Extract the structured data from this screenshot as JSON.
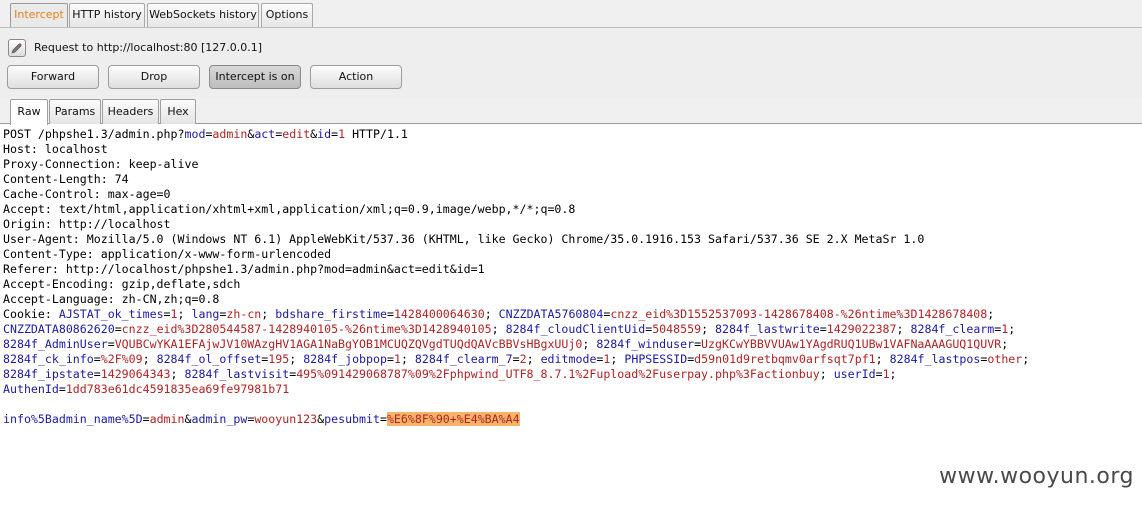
{
  "top_tabs": [
    "Intercept",
    "HTTP history",
    "WebSockets history",
    "Options"
  ],
  "request_label": "Request to http://localhost:80  [127.0.0.1]",
  "buttons": {
    "forward": "Forward",
    "drop": "Drop",
    "intercept": "Intercept is on",
    "action": "Action"
  },
  "sub_tabs": [
    "Raw",
    "Params",
    "Headers",
    "Hex"
  ],
  "request": {
    "request_line": {
      "method_path": "POST /phpshe1.3/admin.php?",
      "params": [
        [
          "mod",
          "admin"
        ],
        [
          "act",
          "edit"
        ],
        [
          "id",
          "1"
        ]
      ],
      "suffix": " HTTP/1.1"
    },
    "headers": [
      "Host: localhost",
      "Proxy-Connection: keep-alive",
      "Content-Length: 74",
      "Cache-Control: max-age=0",
      "Accept: text/html,application/xhtml+xml,application/xml;q=0.9,image/webp,*/*;q=0.8",
      "Origin: http://localhost",
      "User-Agent: Mozilla/5.0 (Windows NT 6.1) AppleWebKit/537.36 (KHTML, like Gecko) Chrome/35.0.1916.153 Safari/537.36 SE 2.X MetaSr 1.0",
      "Content-Type: application/x-www-form-urlencoded",
      "Referer: http://localhost/phpshe1.3/admin.php?mod=admin&act=edit&id=1",
      "Accept-Encoding: gzip,deflate,sdch",
      "Accept-Language: zh-CN,zh;q=0.8"
    ],
    "cookie_label": "Cookie:",
    "cookie_lines": [
      [
        [
          "AJSTAT_ok_times",
          "1"
        ],
        [
          "lang",
          "zh-cn"
        ],
        [
          "bdshare_firstime",
          "1428400064630"
        ],
        [
          "CNZZDATA5760804",
          "cnzz_eid%3D1552537093-1428678408-%26ntime%3D1428678408"
        ]
      ],
      [
        [
          "CNZZDATA80862620",
          "cnzz_eid%3D280544587-1428940105-%26ntime%3D1428940105"
        ],
        [
          "8284f_cloudClientUid",
          "5048559"
        ],
        [
          "8284f_lastwrite",
          "1429022387"
        ],
        [
          "8284f_clearm",
          "1"
        ]
      ],
      [
        [
          "8284f_AdminUser",
          "VQUBCwYKA1EFAjwJV10WAzgHV1AGA1NaBgYOB1MCUQZQVgdTUQdQAVcBBVsHBgxUUj0"
        ],
        [
          "8284f_winduser",
          "UzgKCwYBBVVUAw1YAgdRUQ1UBw1VAFNaAAAGUQ1QUVR"
        ]
      ],
      [
        [
          "8284f_ck_info",
          "%2F%09"
        ],
        [
          "8284f_ol_offset",
          "195"
        ],
        [
          "8284f_jobpop",
          "1"
        ],
        [
          "8284f_clearm_7",
          "2"
        ],
        [
          "editmode",
          "1"
        ],
        [
          "PHPSESSID",
          "d59n01d9retbqmv0arfsqt7pf1"
        ],
        [
          "8284f_lastpos",
          "other"
        ]
      ],
      [
        [
          "8284f_ipstate",
          "1429064343"
        ],
        [
          "8284f_lastvisit",
          "495%091429068787%09%2Fphpwind_UTF8_8.7.1%2Fupload%2Fuserpay.php%3Factionbuy"
        ],
        [
          "userId",
          "1"
        ]
      ],
      [
        [
          "AuthenId",
          "1dd783e61dc4591835ea69fe97981b71"
        ]
      ]
    ],
    "body_params": [
      [
        "info%5Badmin_name%5D",
        "admin"
      ],
      [
        "admin_pw",
        "wooyun123"
      ],
      [
        "pesubmit",
        "%E6%8F%90+%E4%BA%A4"
      ]
    ]
  },
  "watermark": "www.wooyun.org"
}
